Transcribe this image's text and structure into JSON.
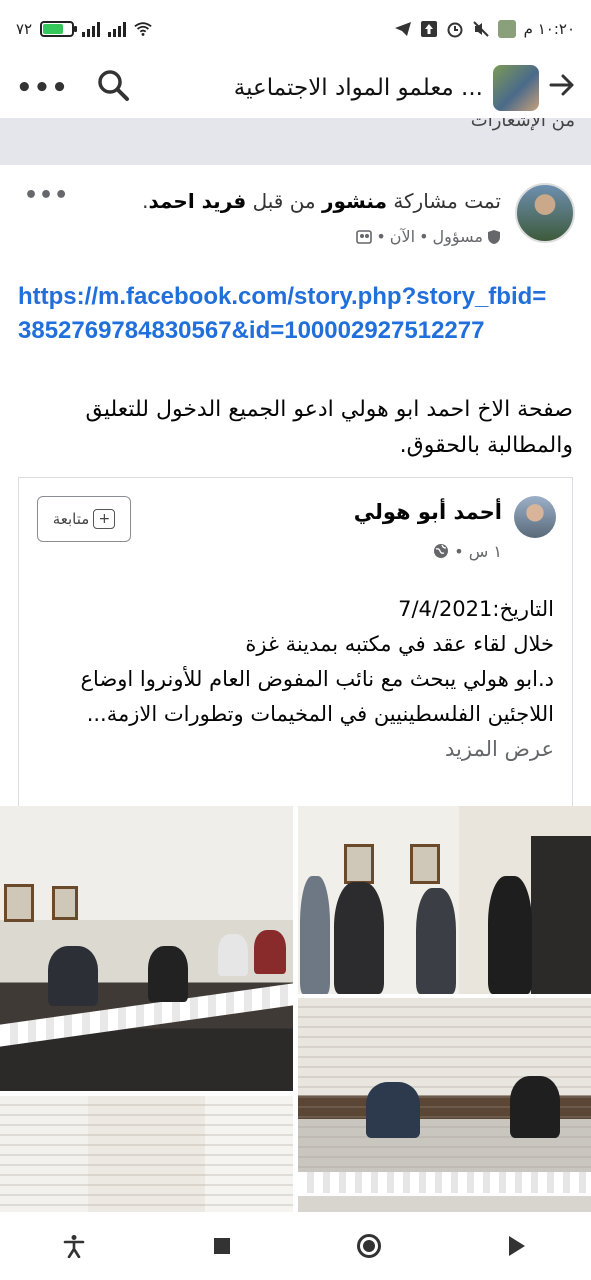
{
  "status_bar": {
    "time": "١٠:٢٠ م",
    "battery_percent": "٧٢",
    "battery_level": 0.72,
    "network": "4G"
  },
  "header": {
    "title": "معلمو المواد الاجتماعية ...",
    "back_icon": "arrow-back-icon",
    "search_icon": "search-icon",
    "more_icon": "more-dots-icon"
  },
  "notice": {
    "text": "من الإشعارات"
  },
  "post": {
    "shared_prefix": "تمت مشاركة",
    "shared_object": "منشور",
    "by_word": "من قبل",
    "author": "فريد احمد",
    "period": ".",
    "role": "مسؤول",
    "time": "الآن",
    "link": "https://m.facebook.com/story.php?story_fbid=3852769784830567&id=100002927512277",
    "text": "صفحة الاخ احمد ابو هولي ادعو الجميع الدخول للتعليق والمطالبة بالحقوق."
  },
  "shared_card": {
    "name": "أحمد أبو هولي",
    "time": "١ س",
    "follow_label": "متابعة",
    "line1": "التاريخ:7/4/2021",
    "line2": "خلال لقاء عقد في مكتبه بمدينة غزة",
    "line3": "د.ابو هولي يبحث مع نائب المفوض العام للأونروا اوضاع اللاجئين الفلسطينيين في المخيمات وتطورات الازمة...",
    "see_more": "عرض المزيد"
  },
  "colors": {
    "link": "#216fdb",
    "secondary_text": "#65676b",
    "notice_bg": "#e4e6eb",
    "battery_green": "#34c759"
  }
}
